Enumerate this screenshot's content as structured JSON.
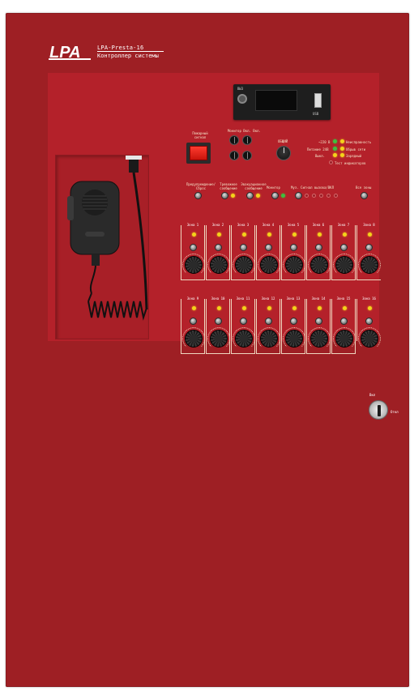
{
  "brand": {
    "logo_text": "LPA",
    "model": "LPA-Presta-16",
    "subtitle": "Контроллер системы"
  },
  "display_unit": {
    "left_label": "ВЫЗ",
    "usb_label": "USB"
  },
  "controls": {
    "fire_alarm_label": "Пожарный сигнал",
    "monitor_vol_label": "Монитор Вкл. Вкл.",
    "master_volume_label": "ОБЩИЙ",
    "prealarm_label": "Предупреждение/ Сброс",
    "evac_msg_label": "Тревожное сообщение",
    "evac_msg2_label": "Эвакуационное сообщение",
    "monitor_label": "Монитор",
    "music_label": "Муз. Сигнал вызова/ВКЛ",
    "all_zones_label": "Все зоны"
  },
  "status_indicators": [
    {
      "label": "~220 В",
      "color": "#3fbf3f"
    },
    {
      "label": "Неисправность",
      "color": "#f4d21b"
    },
    {
      "label": "Питание 24В",
      "color": "#3fbf3f"
    },
    {
      "label": "Обрыв сети",
      "color": "#f4d21b"
    },
    {
      "label": "Выкл.",
      "color": "#f4d21b"
    },
    {
      "label": "Зарядный",
      "color": "#f4d21b"
    },
    {
      "label": "Тест индикаторов",
      "color": "#9a1f27"
    }
  ],
  "zones_row1": [
    "Зона 1",
    "Зона 2",
    "Зона 3",
    "Зона 4",
    "Зона 5",
    "Зона 6",
    "Зона 7",
    "Зона 8"
  ],
  "zones_row2": [
    "Зона 9",
    "Зона 10",
    "Зона 11",
    "Зона 12",
    "Зона 13",
    "Зона 14",
    "Зона 15",
    "Зона 16"
  ],
  "key_switch": {
    "on_label": "Вкл",
    "off_label": "Откл"
  }
}
